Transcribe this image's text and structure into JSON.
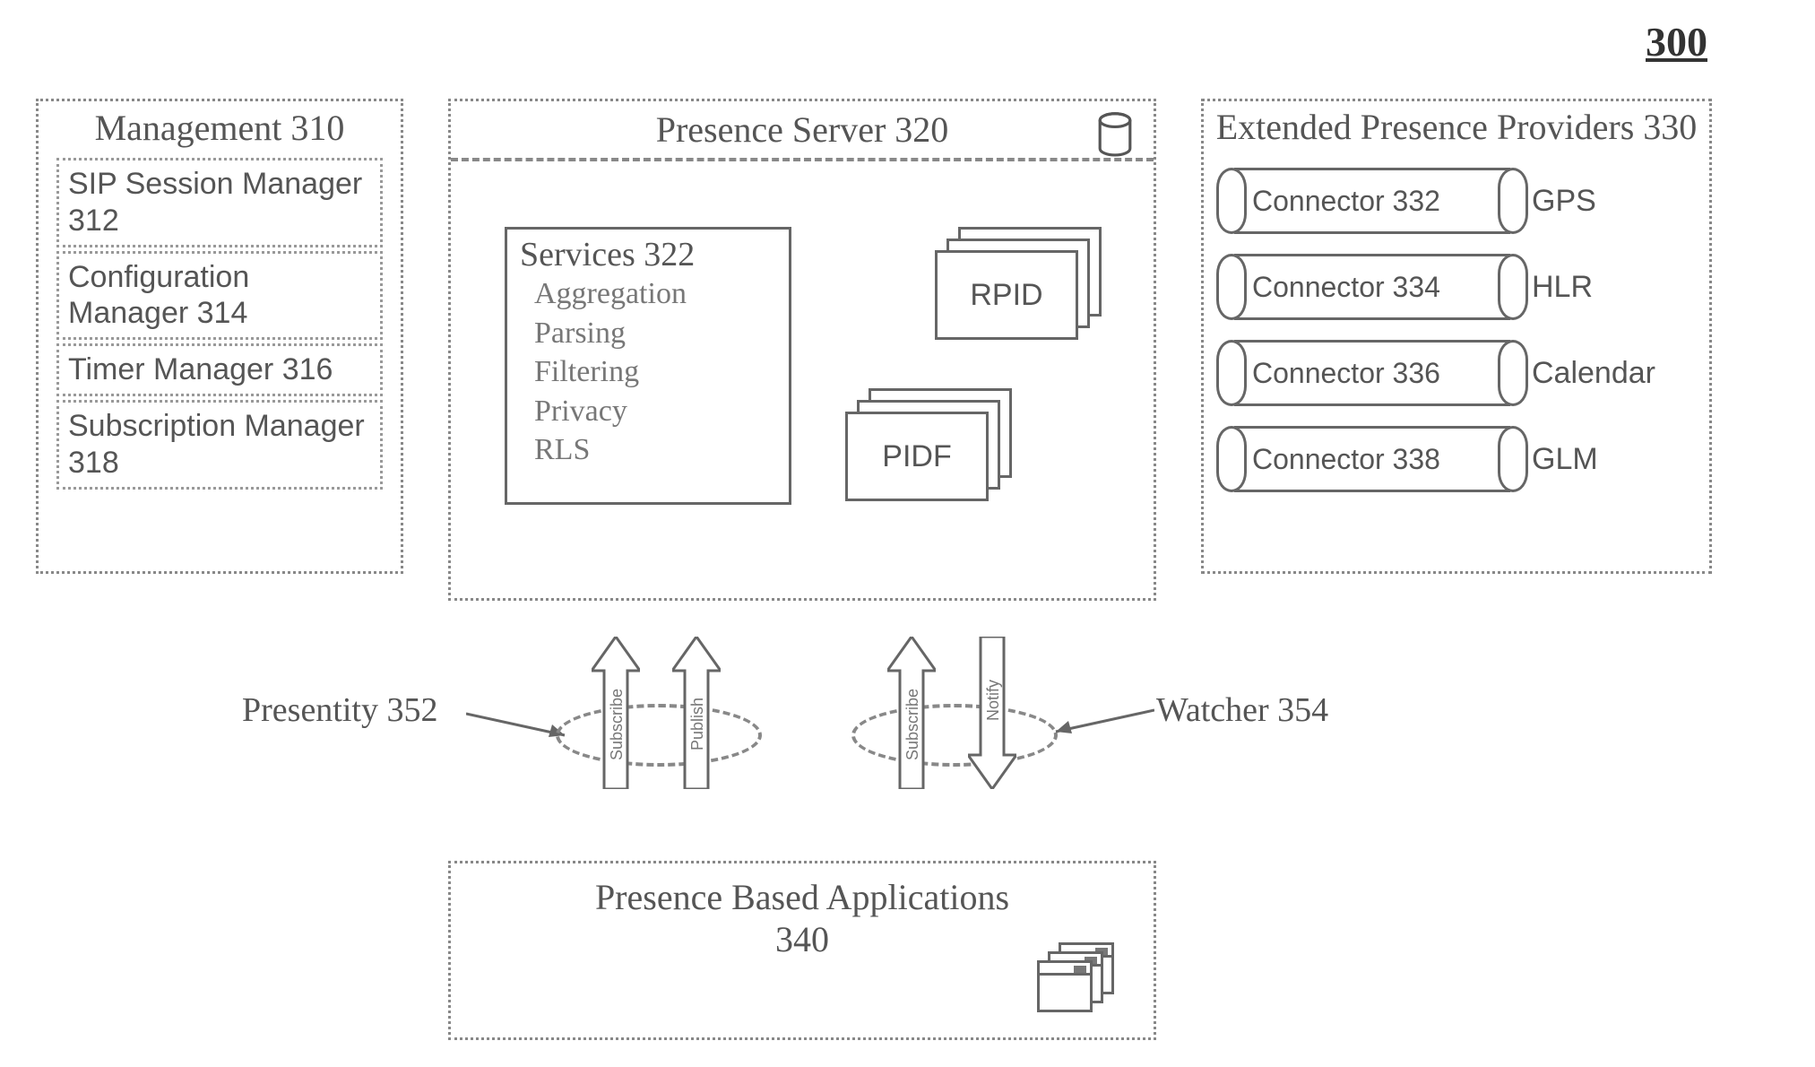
{
  "figure_number": "300",
  "management": {
    "title": "Management 310",
    "items": [
      "SIP Session Manager 312",
      "Configuration Manager 314",
      "Timer Manager 316",
      "Subscription Manager 318"
    ]
  },
  "presence_server": {
    "title": "Presence Server 320",
    "services": {
      "title": "Services 322",
      "list": [
        "Aggregation",
        "Parsing",
        "Filtering",
        "Privacy",
        "RLS"
      ]
    },
    "stacks": {
      "rpid": "RPID",
      "pidf": "PIDF"
    }
  },
  "extended_providers": {
    "title": "Extended Presence Providers 330",
    "rows": [
      {
        "conn": "Connector 332",
        "label": "GPS"
      },
      {
        "conn": "Connector 334",
        "label": "HLR"
      },
      {
        "conn": "Connector 336",
        "label": "Calendar"
      },
      {
        "conn": "Connector 338",
        "label": "GLM"
      }
    ]
  },
  "flows": {
    "presentity": {
      "label": "Presentity 352",
      "arrow1": "Subscribe",
      "arrow2": "Publish"
    },
    "watcher": {
      "label": "Watcher 354",
      "arrow1": "Subscribe",
      "arrow2": "Notify"
    }
  },
  "apps": {
    "title": "Presence Based Applications",
    "sub": "340"
  }
}
